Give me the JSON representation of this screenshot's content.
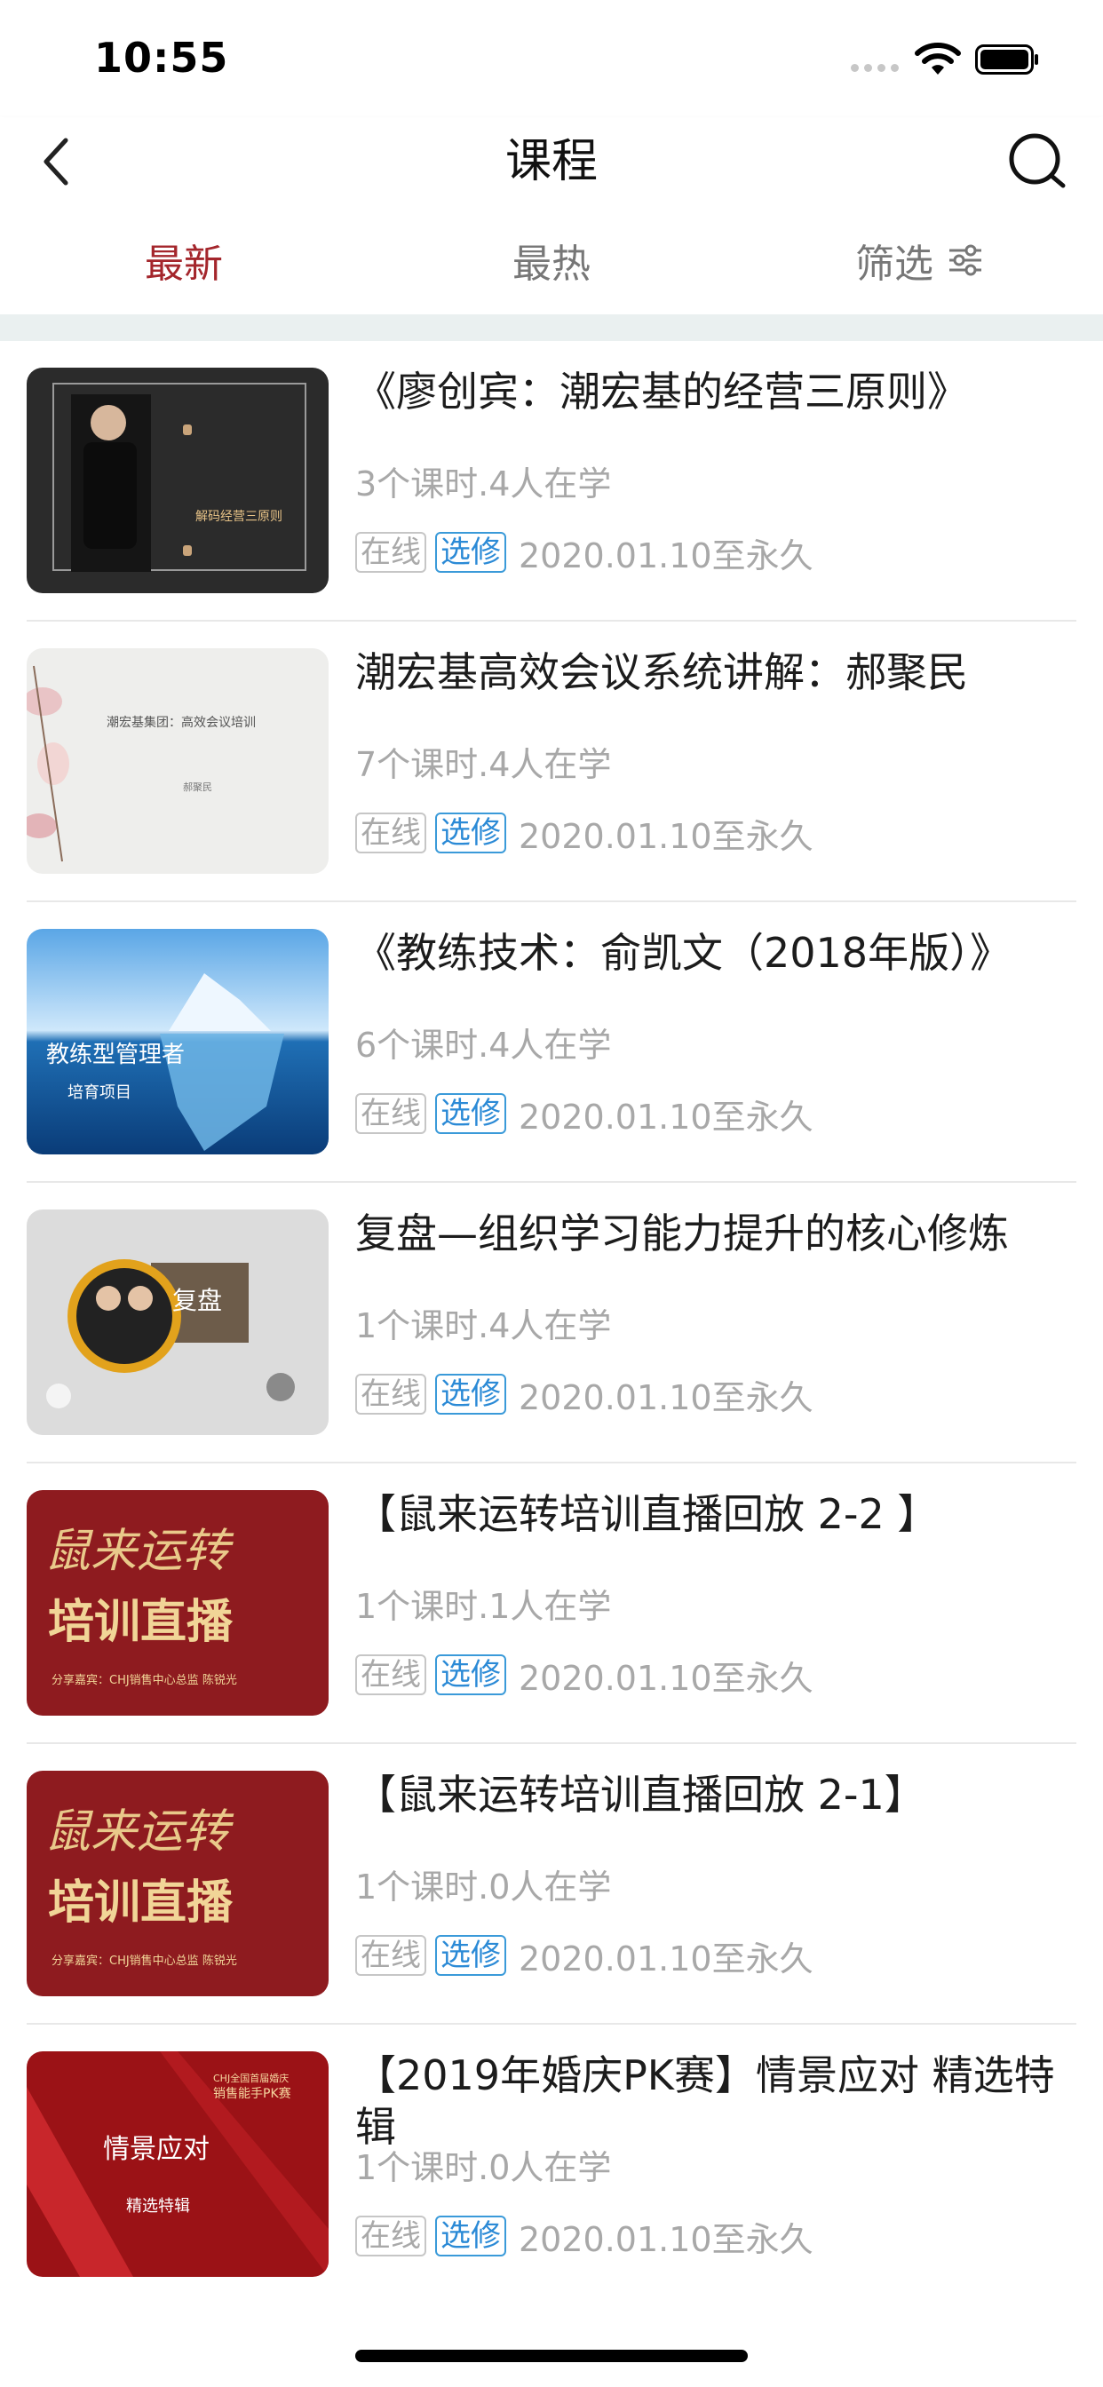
{
  "status_bar": {
    "time": "10:55"
  },
  "nav": {
    "title": "课程"
  },
  "tabs": [
    {
      "label": "最新",
      "active": true
    },
    {
      "label": "最热",
      "active": false
    },
    {
      "label": "筛选",
      "active": false
    }
  ],
  "colors": {
    "accent": "#a4262c",
    "elective_blue": "#2b8ad6",
    "muted": "#a8a8a8"
  },
  "courses": [
    {
      "title": "《廖创宾：潮宏基的经营三原则》",
      "meta": "3个课时.4人在学",
      "tag_online": "在线",
      "tag_elective": "选修",
      "date": "2020.01.10至永久",
      "thumb_text": [
        "解码经营三原则"
      ]
    },
    {
      "title": "潮宏基高效会议系统讲解：郝聚民",
      "meta": "7个课时.4人在学",
      "tag_online": "在线",
      "tag_elective": "选修",
      "date": "2020.01.10至永久",
      "thumb_text": [
        "潮宏基集团：高效会议培训",
        "郝聚民"
      ]
    },
    {
      "title": "《教练技术：俞凯文（2018年版）》",
      "meta": "6个课时.4人在学",
      "tag_online": "在线",
      "tag_elective": "选修",
      "date": "2020.01.10至永久",
      "thumb_text": [
        "教练型管理者",
        "培育项目"
      ]
    },
    {
      "title": "复盘—组织学习能力提升的核心修炼",
      "meta": "1个课时.4人在学",
      "tag_online": "在线",
      "tag_elective": "选修",
      "date": "2020.01.10至永久",
      "thumb_text": [
        "复盘"
      ]
    },
    {
      "title": "【鼠来运转培训直播回放 2-2 】",
      "meta": "1个课时.1人在学",
      "tag_online": "在线",
      "tag_elective": "选修",
      "date": "2020.01.10至永久",
      "thumb_text": [
        "鼠来运转",
        "培训直播",
        "分享嘉宾：CHJ销售中心总监 陈锐光"
      ]
    },
    {
      "title": "【鼠来运转培训直播回放 2-1】",
      "meta": "1个课时.0人在学",
      "tag_online": "在线",
      "tag_elective": "选修",
      "date": "2020.01.10至永久",
      "thumb_text": [
        "鼠来运转",
        "培训直播",
        "分享嘉宾：CHJ销售中心总监 陈锐光"
      ]
    },
    {
      "title": "【2019年婚庆PK赛】情景应对 精选特辑",
      "meta": "1个课时.0人在学",
      "tag_online": "在线",
      "tag_elective": "选修",
      "date": "2020.01.10至永久",
      "thumb_text": [
        "情景应对",
        "精选特辑",
        "CHJ全国首届婚庆",
        "销售能手PK赛"
      ]
    }
  ]
}
